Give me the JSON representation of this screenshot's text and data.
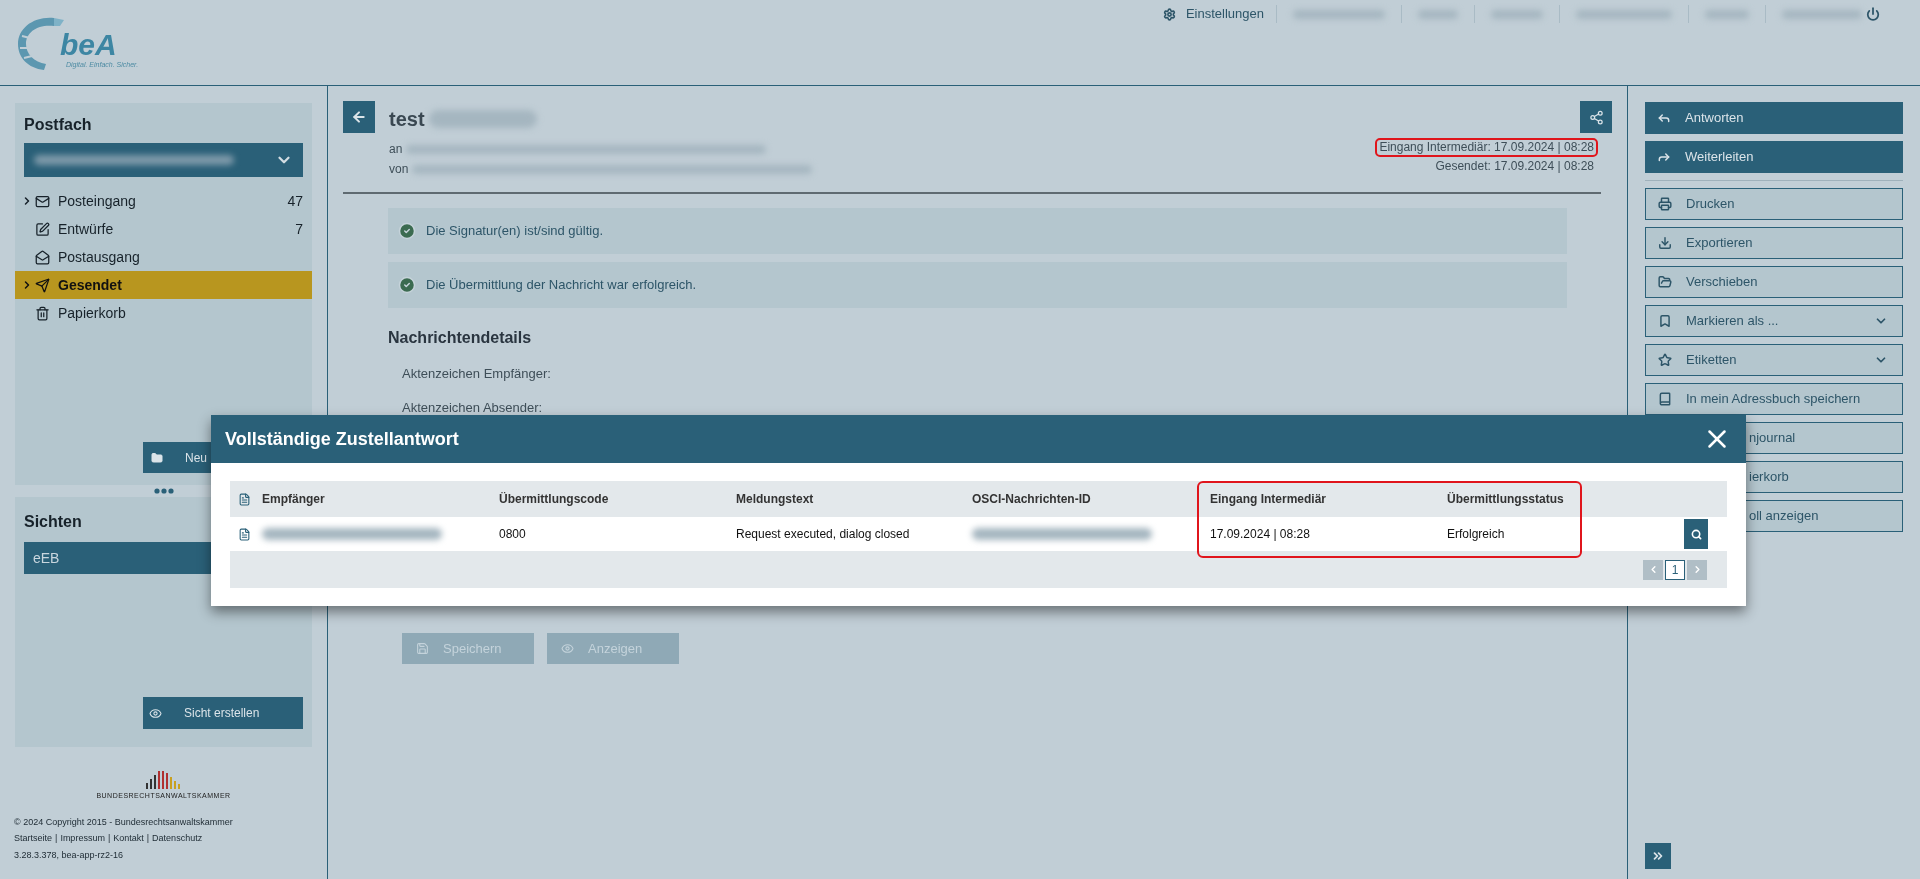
{
  "header": {
    "logo": {
      "name": "beA",
      "tagline": "Digital. Einfach. Sicher."
    },
    "settings_link": "Einstellungen"
  },
  "postfach": {
    "title": "Postfach",
    "folders": [
      {
        "label": "Posteingang",
        "count": "47",
        "expandable": true,
        "selected": false
      },
      {
        "label": "Entwürfe",
        "count": "7",
        "expandable": false,
        "selected": false
      },
      {
        "label": "Postausgang",
        "expandable": false,
        "selected": false
      },
      {
        "label": "Gesendet",
        "expandable": true,
        "selected": true
      },
      {
        "label": "Papierkorb",
        "expandable": false,
        "selected": false
      }
    ],
    "new_button": "Neu"
  },
  "sichten": {
    "title": "Sichten",
    "items": [
      "eEB"
    ],
    "create_button": "Sicht erstellen"
  },
  "footer": {
    "org": "BUNDESRECHTSANWALTSKAMMER",
    "copyright": "© 2024 Copyright 2015 - Bundesrechtsanwaltskammer",
    "links": [
      "Startseite",
      "Impressum",
      "Kontakt",
      "Datenschutz"
    ],
    "link_separator": "|",
    "version": "3.28.3.378, bea-app-rz2-16"
  },
  "message": {
    "subject": "test",
    "to_label": "an",
    "from_label": "von",
    "dates": [
      {
        "text": "Eingang Intermediär: 17.09.2024 | 08:28",
        "highlighted": true
      },
      {
        "text": "Gesendet: 17.09.2024 | 08:28",
        "highlighted": false
      }
    ],
    "alerts": [
      "Die Signatur(en) ist/sind gültig.",
      "Die Übermittlung der Nachricht war erfolgreich."
    ],
    "details_title": "Nachrichtendetails",
    "details": [
      "Aktenzeichen Empfänger:",
      "Aktenzeichen Absender:"
    ],
    "buttons": [
      {
        "label": "Speichern",
        "disabled": true
      },
      {
        "label": "Anzeigen",
        "disabled": true
      }
    ]
  },
  "actions": [
    {
      "label": "Antworten",
      "kind": "primary"
    },
    {
      "label": "Weiterleiten",
      "kind": "primary"
    },
    {
      "label": "Drucken",
      "kind": "outline"
    },
    {
      "label": "Exportieren",
      "kind": "outline"
    },
    {
      "label": "Verschieben",
      "kind": "outline"
    },
    {
      "label": "Markieren als ...",
      "kind": "dropdown"
    },
    {
      "label": "Etiketten",
      "kind": "dropdown"
    },
    {
      "label": "In mein Adressbuch speichern",
      "kind": "outline"
    },
    {
      "label": "njournal",
      "kind": "covered"
    },
    {
      "label": "ierkorb",
      "kind": "covered"
    },
    {
      "label": "oll anzeigen",
      "kind": "covered"
    }
  ],
  "modal": {
    "title": "Vollständige Zustellantwort",
    "columns": [
      {
        "label": "Empfänger",
        "highlighted": false
      },
      {
        "label": "Übermittlungscode",
        "highlighted": false
      },
      {
        "label": "Meldungstext",
        "highlighted": false
      },
      {
        "label": "OSCI-Nachrichten-ID",
        "highlighted": false
      },
      {
        "label": "Eingang Intermediär",
        "highlighted": true
      },
      {
        "label": "Übermittlungsstatus",
        "highlighted": true
      }
    ],
    "rows": [
      {
        "cells": [
          {
            "kind": "redacted"
          },
          {
            "kind": "text",
            "text": "0800"
          },
          {
            "kind": "text",
            "text": "Request executed, dialog closed"
          },
          {
            "kind": "redacted"
          },
          {
            "kind": "text",
            "text": "17.09.2024 | 08:28"
          },
          {
            "kind": "text",
            "text": "Erfolgreich"
          }
        ]
      }
    ],
    "page": "1"
  }
}
